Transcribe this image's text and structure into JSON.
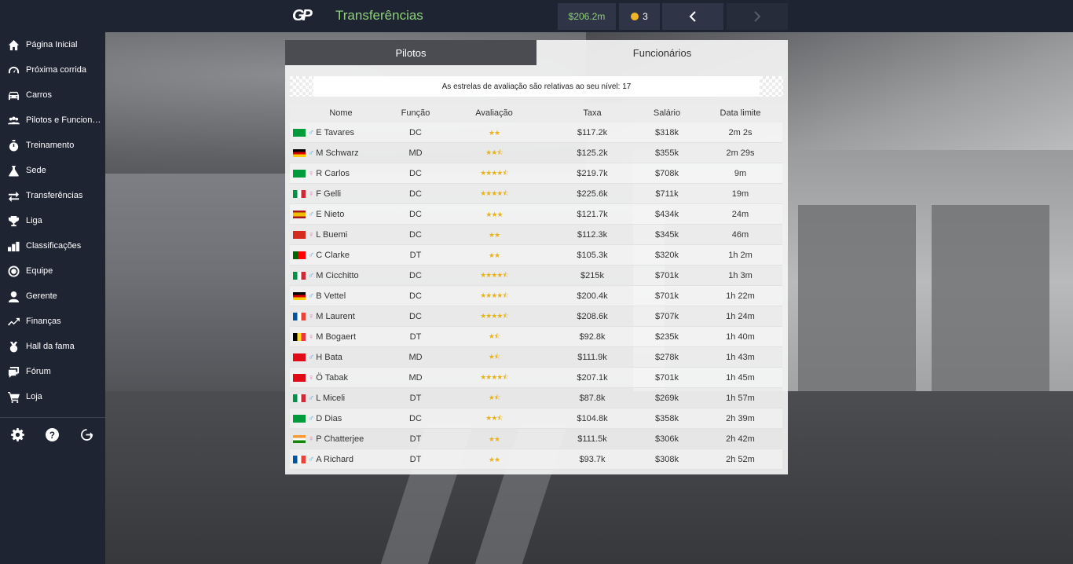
{
  "topbar": {
    "logo": "GP",
    "title": "Transferências",
    "money": "$206.2m",
    "tokens": "3",
    "prev_icon": "chevron-left-icon",
    "next_icon": "chevron-right-icon"
  },
  "sidebar": {
    "items": [
      {
        "label": "Página Inicial",
        "icon": "home-icon"
      },
      {
        "label": "Próxima corrida",
        "icon": "speedometer-icon"
      },
      {
        "label": "Carros",
        "icon": "car-icon"
      },
      {
        "label": "Pilotos e Funcionários",
        "icon": "people-icon"
      },
      {
        "label": "Treinamento",
        "icon": "stopwatch-icon"
      },
      {
        "label": "Sede",
        "icon": "flask-icon"
      },
      {
        "label": "Transferências",
        "icon": "transfer-icon"
      },
      {
        "label": "Liga",
        "icon": "trophy-icon"
      },
      {
        "label": "Classificações",
        "icon": "bar-chart-icon"
      },
      {
        "label": "Equipe",
        "icon": "target-icon"
      },
      {
        "label": "Gerente",
        "icon": "user-icon"
      },
      {
        "label": "Finanças",
        "icon": "trend-icon"
      },
      {
        "label": "Hall da fama",
        "icon": "award-icon"
      },
      {
        "label": "Fórum",
        "icon": "chat-icon"
      },
      {
        "label": "Loja",
        "icon": "cart-icon"
      }
    ],
    "bottom": [
      "gear-icon",
      "help-icon",
      "logout-icon"
    ]
  },
  "tabs": {
    "pilotos": "Pilotos",
    "funcionarios": "Funcionários",
    "active": "funcionarios"
  },
  "notice": "As estrelas de avaliação são relativas ao seu nível: 17",
  "table": {
    "headers": {
      "name": "Nome",
      "func": "Função",
      "rating": "Avaliação",
      "taxa": "Taxa",
      "salary": "Salário",
      "deadline": "Data limite"
    },
    "rows": [
      {
        "flag": "BR",
        "sex": "m",
        "name": "E Tavares",
        "func": "DC",
        "stars": "★★",
        "taxa": "$117.2k",
        "salary": "$318k",
        "deadline": "2m 2s"
      },
      {
        "flag": "DE",
        "sex": "m",
        "name": "M Schwarz",
        "func": "MD",
        "stars": "★★⯪",
        "taxa": "$125.2k",
        "salary": "$355k",
        "deadline": "2m 29s"
      },
      {
        "flag": "BR",
        "sex": "f",
        "name": "R Carlos",
        "func": "DC",
        "stars": "★★★★⯪",
        "taxa": "$219.7k",
        "salary": "$708k",
        "deadline": "9m"
      },
      {
        "flag": "IT",
        "sex": "f",
        "name": "F Gelli",
        "func": "DC",
        "stars": "★★★★⯪",
        "taxa": "$225.6k",
        "salary": "$711k",
        "deadline": "19m"
      },
      {
        "flag": "ES",
        "sex": "m",
        "name": "E Nieto",
        "func": "DC",
        "stars": "★★★",
        "taxa": "$121.7k",
        "salary": "$434k",
        "deadline": "24m"
      },
      {
        "flag": "CH",
        "sex": "f",
        "name": "L Buemi",
        "func": "DC",
        "stars": "★★",
        "taxa": "$112.3k",
        "salary": "$345k",
        "deadline": "46m"
      },
      {
        "flag": "PT",
        "sex": "m",
        "name": "C Clarke",
        "func": "DT",
        "stars": "★★",
        "taxa": "$105.3k",
        "salary": "$320k",
        "deadline": "1h 2m"
      },
      {
        "flag": "IT",
        "sex": "m",
        "name": "M Cicchitto",
        "func": "DC",
        "stars": "★★★★⯪",
        "taxa": "$215k",
        "salary": "$701k",
        "deadline": "1h 3m"
      },
      {
        "flag": "DE",
        "sex": "m",
        "name": "B Vettel",
        "func": "DC",
        "stars": "★★★★⯪",
        "taxa": "$200.4k",
        "salary": "$701k",
        "deadline": "1h 22m"
      },
      {
        "flag": "FR",
        "sex": "f",
        "name": "M Laurent",
        "func": "DC",
        "stars": "★★★★⯪",
        "taxa": "$208.6k",
        "salary": "$707k",
        "deadline": "1h 24m"
      },
      {
        "flag": "BE",
        "sex": "f",
        "name": "M Bogaert",
        "func": "DT",
        "stars": "★⯪",
        "taxa": "$92.8k",
        "salary": "$235k",
        "deadline": "1h 40m"
      },
      {
        "flag": "TR",
        "sex": "m",
        "name": "H Bata",
        "func": "MD",
        "stars": "★⯪",
        "taxa": "$111.9k",
        "salary": "$278k",
        "deadline": "1h 43m"
      },
      {
        "flag": "TR",
        "sex": "f",
        "name": "Ö Tabak",
        "func": "MD",
        "stars": "★★★★⯪",
        "taxa": "$207.1k",
        "salary": "$701k",
        "deadline": "1h 45m"
      },
      {
        "flag": "IT",
        "sex": "m",
        "name": "L Miceli",
        "func": "DT",
        "stars": "★⯪",
        "taxa": "$87.8k",
        "salary": "$269k",
        "deadline": "1h 57m"
      },
      {
        "flag": "BR",
        "sex": "m",
        "name": "D Dias",
        "func": "DC",
        "stars": "★★⯪",
        "taxa": "$104.8k",
        "salary": "$358k",
        "deadline": "2h 39m"
      },
      {
        "flag": "IN",
        "sex": "f",
        "name": "P Chatterjee",
        "func": "DT",
        "stars": "★★",
        "taxa": "$111.5k",
        "salary": "$306k",
        "deadline": "2h 42m"
      },
      {
        "flag": "FR",
        "sex": "m",
        "name": "A Richard",
        "func": "DT",
        "stars": "★★",
        "taxa": "$93.7k",
        "salary": "$308k",
        "deadline": "2h 52m"
      }
    ]
  },
  "colors": {
    "accent_green": "#8fd17a",
    "star": "#e8b21f",
    "sidebar_bg": "#1f2433"
  }
}
